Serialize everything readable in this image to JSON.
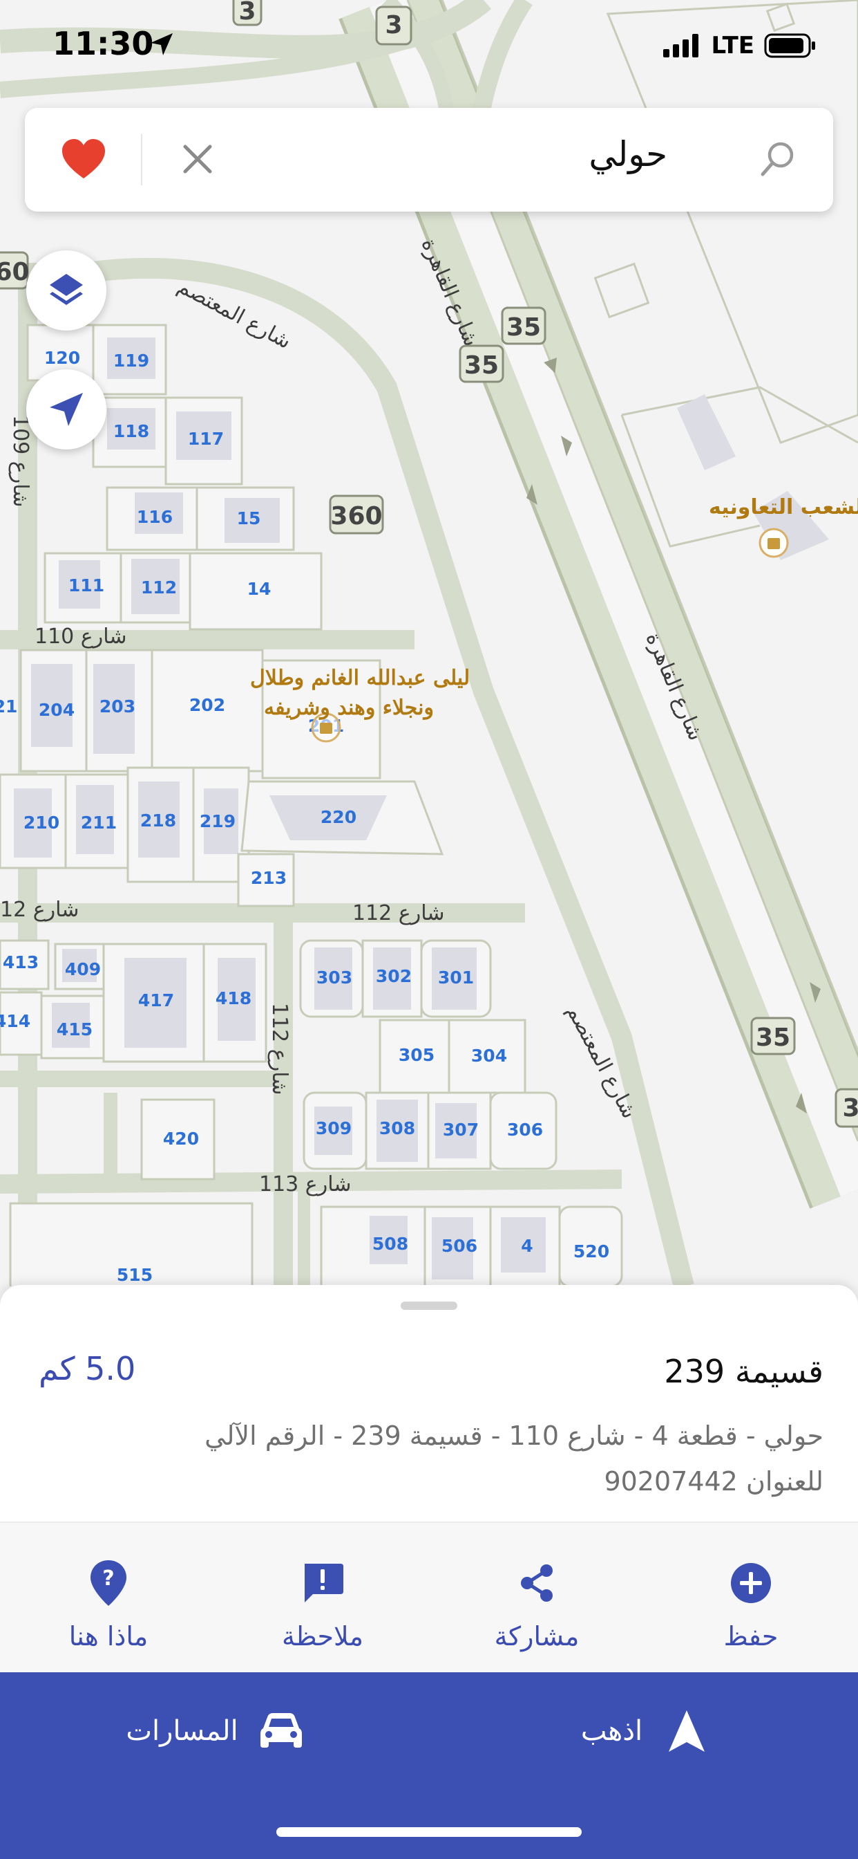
{
  "status_bar": {
    "time": "11:30",
    "network": "LTE"
  },
  "search": {
    "query": "حولي"
  },
  "map": {
    "lots": [
      "120",
      "119",
      "118",
      "117",
      "116",
      "15",
      "111",
      "112",
      "14",
      "204",
      "203",
      "202",
      "201",
      "210",
      "211",
      "218",
      "219",
      "220",
      "213",
      "413",
      "409",
      "417",
      "418",
      "414",
      "415",
      "303",
      "302",
      "301",
      "305",
      "304",
      "309",
      "308",
      "307",
      "306",
      "420",
      "508",
      "506",
      "4",
      "520",
      "515",
      "21"
    ],
    "route_shields": [
      "3",
      "3",
      "35",
      "35",
      "360",
      "35",
      "3"
    ],
    "street_labels": [
      "شارع المعتصم",
      "شارع القاهرة",
      "شارع 110",
      "شارع 112",
      "شارع 112",
      "شارع 113",
      "شارع المعتصم",
      "شارع القاهرة",
      "شارع 109",
      "شارع 12"
    ],
    "pois": {
      "coop_store": "ه الشعب التعاونيه",
      "owner_line1": "ليلى عبدالله الغانم وطلال",
      "owner_line2": "ونجلاء وهند وشريفه"
    }
  },
  "sheet": {
    "title": "قسيمة 239",
    "distance": "5.0 كم",
    "address_line1": "حولي - قطعة 4 - شارع 110 - قسيمة 239 - الرقم الآلي",
    "address_line2": "للعنوان 90207442"
  },
  "actions": {
    "save": "حفظ",
    "share": "مشاركة",
    "note": "ملاحظة",
    "whats_here": "ماذا هنا"
  },
  "nav": {
    "go": "اذهب",
    "routes": "المسارات"
  },
  "colors": {
    "accent": "#3c50b4",
    "favorite": "#e8402f",
    "lot_number": "#2c6fd6",
    "poi_text": "#b07a10"
  },
  "icons": [
    "location-arrow-icon",
    "signal-icon",
    "battery-icon",
    "heart-icon",
    "close-icon",
    "search-icon",
    "layers-icon",
    "navigate-icon",
    "plus-circle-icon",
    "share-icon",
    "note-icon",
    "help-pin-icon",
    "car-icon",
    "navigation-arrow-icon"
  ]
}
